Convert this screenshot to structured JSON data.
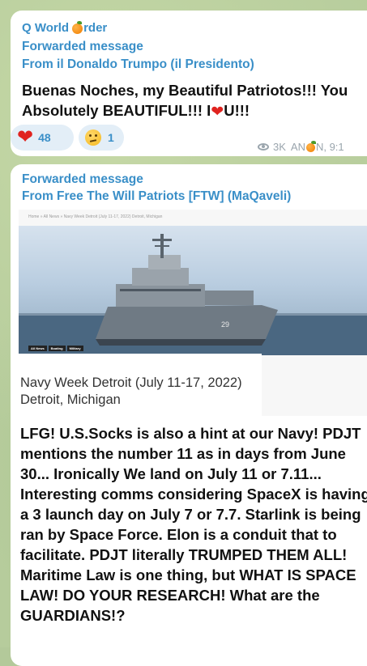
{
  "post1": {
    "channel_prefix": "Q World ",
    "channel_icon": "orange-emoji",
    "channel_suffix": "rder",
    "forwarded_label": "Forwarded message",
    "from": "From il Donaldo Trumpo (il Presidento)",
    "text_line1": "Buenas Noches, my Beautiful Patriotos!!! You",
    "text_line2_a": "Absolutely BEAUTIFUL!!! I",
    "text_line2_heart": "❤",
    "text_line2_b": "U!!!",
    "reactions": [
      {
        "emoji": "red-heart",
        "count": "48"
      },
      {
        "emoji": "thinking-face",
        "count": "1"
      }
    ],
    "views": "3K",
    "author_prefix": "AN",
    "author_icon": "orange-emoji",
    "author_suffix": "N, 9:1"
  },
  "post2": {
    "forwarded_label": "Forwarded message",
    "from": "From Free The Will Patriots [FTW] (MaQaveli)",
    "article": {
      "breadcrumb": "Home » All News » Navy Week Detroit (July 11-17, 2022) Detroit, Michigan",
      "tags": [
        "All News",
        "Boating",
        "Military"
      ],
      "caption": "Navy Week Detroit (July 11-17, 2022) Detroit, Michigan",
      "image": "navy-ship-photo"
    },
    "text": "LFG! U.S.Socks is also a hint at our Navy! PDJT mentions the number 11 as in days from June 30... Ironically We land on July 11 or 7.11... Interesting comms considering SpaceX is having a 3 launch day on July 7 or 7.7. Starlink is being ran by Space Force. Elon is a conduit that to facilitate. PDJT literally TRUMPED THEM ALL! Maritime Law is one thing, but WHAT IS SPACE LAW! DO YOUR RESEARCH! What are the GUARDIANS!?"
  },
  "colors": {
    "link_blue": "#3a8fc8",
    "reaction_bg": "#e3eef7",
    "heart_red": "#e0231f",
    "wallpaper": "#b6cc9c"
  }
}
